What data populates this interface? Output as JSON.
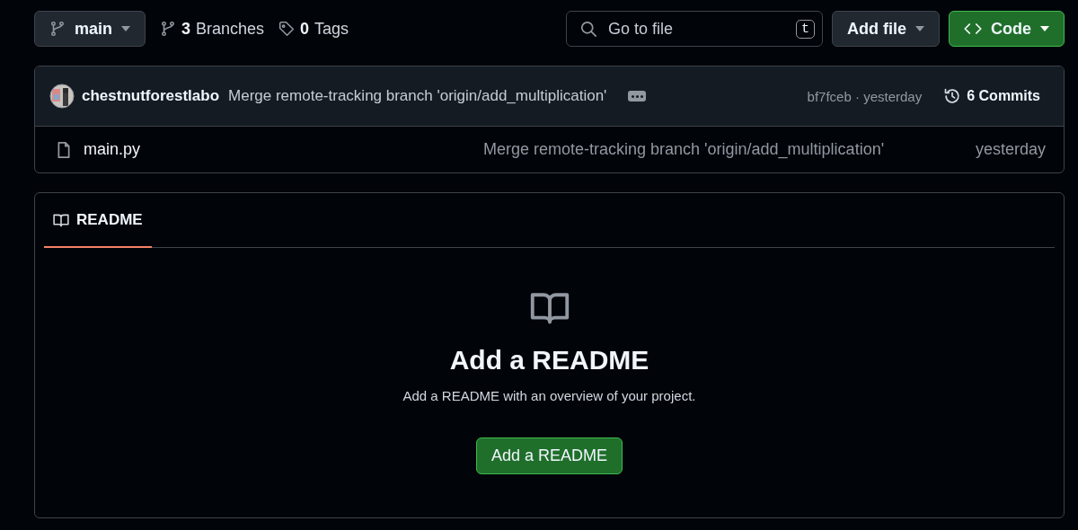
{
  "branch_selector": {
    "label": "main"
  },
  "branches": {
    "count": "3",
    "label": "Branches"
  },
  "tags": {
    "count": "0",
    "label": "Tags"
  },
  "file_search": {
    "placeholder": "Go to file",
    "shortcut": "t"
  },
  "add_file_button": {
    "label": "Add file"
  },
  "code_button": {
    "label": "Code"
  },
  "latest_commit": {
    "author": "chestnutforestlabo",
    "message": "Merge remote-tracking branch 'origin/add_multiplication'",
    "hash": "bf7fceb",
    "separator": "·",
    "time": "yesterday",
    "commits": "6 Commits"
  },
  "files": [
    {
      "name": "main.py",
      "message": "Merge remote-tracking branch 'origin/add_multiplication'",
      "time": "yesterday"
    }
  ],
  "readme_tabs": [
    {
      "label": "README",
      "selected": true
    }
  ],
  "readme_empty": {
    "title": "Add a README",
    "description": "Add a README with an overview of your project.",
    "button": "Add a README"
  }
}
